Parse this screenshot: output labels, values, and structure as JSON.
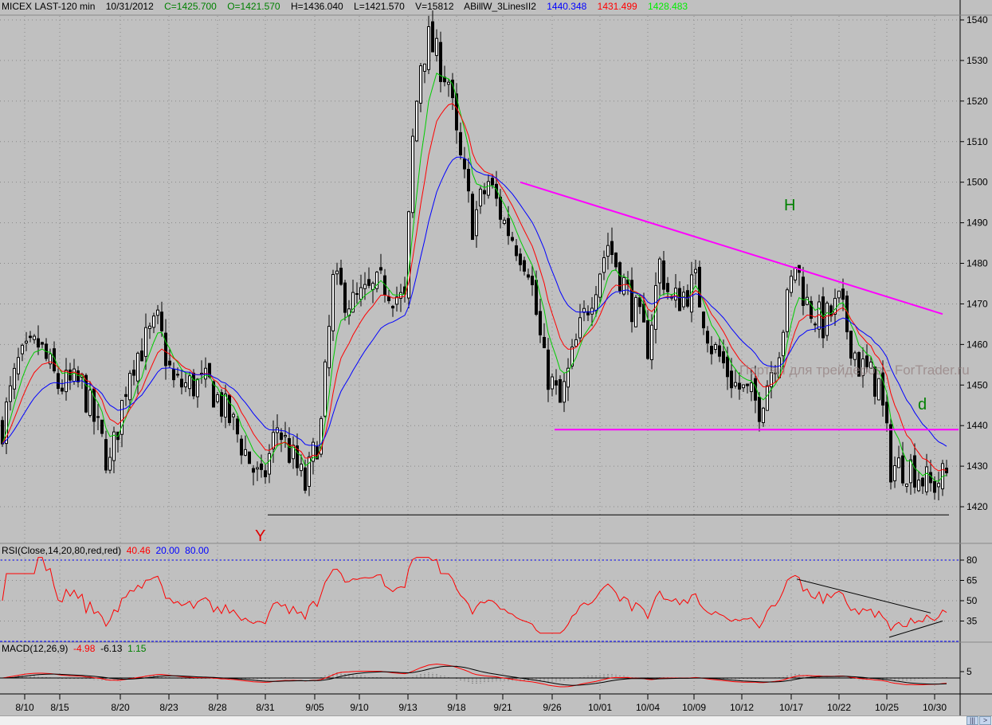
{
  "header": {
    "symbol": "MICEX LAST-120 min",
    "date": "10/31/2012",
    "close": "C=1425.700",
    "open": "O=1421.570",
    "high": "H=1436.040",
    "low": "L=1421.570",
    "volume": "V=15812",
    "indicator": "ABillW_3LinesII2",
    "ma_blue": "1440.348",
    "ma_red": "1431.499",
    "ma_green": "1428.483"
  },
  "rsi_header": {
    "name": "RSI(Close,14,20,80,red,red)",
    "value": "40.46",
    "low": "20.00",
    "high": "80.00"
  },
  "macd_header": {
    "name": "MACD(12,26,9)",
    "macd": "-4.98",
    "signal": "-6.13",
    "hist": "1.15"
  },
  "watermark": "Портал для трейдеров - ForTrader.ru",
  "annotations": {
    "y_label": "Y",
    "h_label": "H",
    "d_label": "d"
  },
  "colors": {
    "bg": "#c0c0c0",
    "blue": "#0000ff",
    "red": "#ff0000",
    "green": "#00cc00",
    "magenta": "#ff00ff",
    "header_green": "#008000"
  },
  "chart_data": [
    {
      "type": "candlestick",
      "title": "MICEX LAST-120 min",
      "yticks": [
        "1420",
        "1430",
        "1440",
        "1450",
        "1460",
        "1470",
        "1480",
        "1490",
        "1500",
        "1510",
        "1520",
        "1530",
        "1540"
      ],
      "ylim": [
        1414,
        1544
      ],
      "xticks": [
        "8/10",
        "8/15",
        "8/20",
        "8/23",
        "8/28",
        "8/31",
        "9/05",
        "9/10",
        "9/13",
        "9/18",
        "9/21",
        "9/26",
        "10/01",
        "10/04",
        "10/09",
        "10/12",
        "10/17",
        "10/22",
        "10/25",
        "10/30"
      ],
      "xtick_bar_index": [
        5.6,
        14.4,
        29.6,
        41.8,
        54,
        66,
        78.4,
        89.6,
        101.8,
        114,
        125.6,
        138,
        150,
        162,
        173.6,
        185.6,
        198,
        210,
        222,
        234
      ],
      "bar_count": 238,
      "close_path_bar_price": [
        [
          0,
          1440
        ],
        [
          4,
          1455
        ],
        [
          9,
          1460
        ],
        [
          14,
          1450
        ],
        [
          20,
          1450
        ],
        [
          27,
          1430
        ],
        [
          32,
          1455
        ],
        [
          39,
          1465
        ],
        [
          43,
          1450
        ],
        [
          52,
          1450
        ],
        [
          58,
          1440
        ],
        [
          65,
          1425
        ],
        [
          69,
          1440
        ],
        [
          76,
          1425
        ],
        [
          80,
          1440
        ],
        [
          83,
          1475
        ],
        [
          88,
          1470
        ],
        [
          96,
          1475
        ],
        [
          101,
          1470
        ],
        [
          103,
          1510
        ],
        [
          105,
          1530
        ],
        [
          107,
          1535
        ],
        [
          112,
          1525
        ],
        [
          114,
          1510
        ],
        [
          118,
          1490
        ],
        [
          122,
          1500
        ],
        [
          126,
          1490
        ],
        [
          132,
          1480
        ],
        [
          136,
          1455
        ],
        [
          140,
          1445
        ],
        [
          144,
          1460
        ],
        [
          147,
          1470
        ],
        [
          152,
          1485
        ],
        [
          158,
          1470
        ],
        [
          162,
          1460
        ],
        [
          165,
          1480
        ],
        [
          168,
          1470
        ],
        [
          174,
          1475
        ],
        [
          178,
          1460
        ],
        [
          184,
          1450
        ],
        [
          190,
          1445
        ],
        [
          195,
          1460
        ],
        [
          199,
          1480
        ],
        [
          202,
          1470
        ],
        [
          206,
          1465
        ],
        [
          210,
          1470
        ],
        [
          215,
          1455
        ],
        [
          220,
          1450
        ],
        [
          223,
          1430
        ],
        [
          228,
          1430
        ],
        [
          233,
          1425
        ],
        [
          237,
          1428
        ]
      ],
      "series": [
        {
          "name": "MA fast",
          "color": "#00cc00",
          "last": 1428.483
        },
        {
          "name": "MA mid",
          "color": "#ff0000",
          "last": 1431.499
        },
        {
          "name": "MA slow",
          "color": "#0000ff",
          "last": 1440.348
        }
      ],
      "trendlines": [
        {
          "name": "resistance",
          "color": "#ff00ff",
          "from": [
            130,
            1500
          ],
          "to": [
            236,
            1467.5
          ]
        },
        {
          "name": "neckline",
          "color": "#ff00ff",
          "from": [
            138.6,
            1439
          ],
          "to": [
            240,
            1439
          ]
        },
        {
          "name": "support",
          "color": "#000000",
          "from": [
            66.6,
            1418
          ],
          "to": [
            237.6,
            1418
          ]
        }
      ],
      "annotations": [
        {
          "text": "Y",
          "bar": 65.6,
          "price": 1413
        },
        {
          "text": "H",
          "bar": 198.4,
          "price": 1493
        },
        {
          "text": "d",
          "bar": 231.6,
          "price": 1444
        }
      ]
    },
    {
      "type": "line",
      "title": "RSI(Close,14,20,80,red,red)",
      "yticks": [
        "35",
        "50",
        "65",
        "80"
      ],
      "levels": [
        20,
        80
      ],
      "ylim": [
        20,
        85
      ],
      "last": 40.46,
      "trendlines": [
        {
          "from": [
            199.4,
            66
          ],
          "to": [
            233,
            41
          ]
        },
        {
          "from": [
            222.6,
            23
          ],
          " to": [
            236,
            35
          ]
        }
      ]
    },
    {
      "type": "line",
      "title": "MACD(12,26,9)",
      "yticks": [
        "5"
      ],
      "macd": -4.98,
      "signal": -6.13,
      "hist": 1.15
    }
  ]
}
